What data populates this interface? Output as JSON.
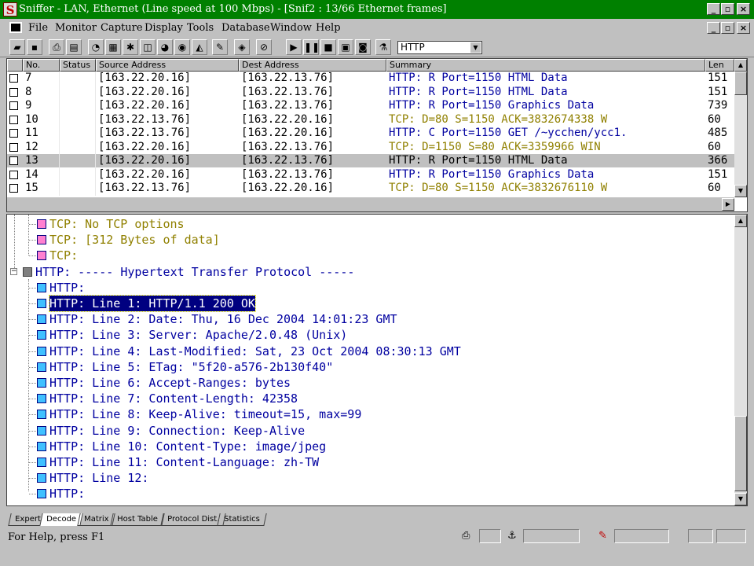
{
  "window": {
    "title": "Sniffer - LAN, Ethernet (Line speed at 100 Mbps) - [Snif2 : 13/66 Ethernet frames]",
    "logo": "S"
  },
  "menu": [
    "File",
    "Monitor",
    "Capture",
    "Display",
    "Tools",
    "Database",
    "Window",
    "Help"
  ],
  "toolbar": {
    "filter_value": "HTTP"
  },
  "packet_list": {
    "columns": [
      "No.",
      "Status",
      "Source Address",
      "Dest Address",
      "Summary",
      "Len"
    ],
    "rows": [
      {
        "no": "7",
        "src": "[163.22.20.16]",
        "dst": "[163.22.13.76]",
        "summary": "HTTP: R Port=1150 HTML Data",
        "len": "151",
        "proto": "http"
      },
      {
        "no": "8",
        "src": "[163.22.20.16]",
        "dst": "[163.22.13.76]",
        "summary": "HTTP: R Port=1150 HTML Data",
        "len": "151",
        "proto": "http"
      },
      {
        "no": "9",
        "src": "[163.22.20.16]",
        "dst": "[163.22.13.76]",
        "summary": "HTTP: R Port=1150 Graphics Data",
        "len": "739",
        "proto": "http"
      },
      {
        "no": "10",
        "src": "[163.22.13.76]",
        "dst": "[163.22.20.16]",
        "summary": "TCP: D=80 S=1150      ACK=3832674338 W",
        "len": "60",
        "proto": "tcp"
      },
      {
        "no": "11",
        "src": "[163.22.13.76]",
        "dst": "[163.22.20.16]",
        "summary": "HTTP: C Port=1150 GET /~ycchen/ycc1.",
        "len": "485",
        "proto": "http"
      },
      {
        "no": "12",
        "src": "[163.22.20.16]",
        "dst": "[163.22.13.76]",
        "summary": "TCP: D=1150 S=80      ACK=3359966 WIN",
        "len": "60",
        "proto": "tcp"
      },
      {
        "no": "13",
        "src": "[163.22.20.16]",
        "dst": "[163.22.13.76]",
        "summary": "HTTP: R Port=1150 HTML Data",
        "len": "366",
        "proto": "black",
        "selected": true
      },
      {
        "no": "14",
        "src": "[163.22.20.16]",
        "dst": "[163.22.13.76]",
        "summary": "HTTP: R Port=1150 Graphics Data",
        "len": "151",
        "proto": "http"
      },
      {
        "no": "15",
        "src": "[163.22.13.76]",
        "dst": "[163.22.20.16]",
        "summary": "TCP: D=80 S=1150      ACK=3832676110 W",
        "len": "60",
        "proto": "tcp"
      }
    ]
  },
  "decode": {
    "lines": [
      {
        "text": "TCP: No TCP options",
        "proto": "tcp",
        "level": 2
      },
      {
        "text": "TCP: [312 Bytes of data]",
        "proto": "tcp",
        "level": 2
      },
      {
        "text": "TCP:",
        "proto": "tcp",
        "level": 2
      },
      {
        "text": "HTTP: ----- Hypertext Transfer Protocol -----",
        "proto": "http",
        "level": 1
      },
      {
        "text": "HTTP:",
        "proto": "http",
        "level": 2
      },
      {
        "text": "HTTP: Line  1:  HTTP/1.1 200 OK",
        "proto": "http",
        "level": 2,
        "selected": true
      },
      {
        "text": "HTTP: Line  2:  Date: Thu, 16 Dec 2004 14:01:23 GMT",
        "proto": "http",
        "level": 2
      },
      {
        "text": "HTTP: Line  3:  Server: Apache/2.0.48 (Unix)",
        "proto": "http",
        "level": 2
      },
      {
        "text": "HTTP: Line  4:  Last-Modified: Sat, 23 Oct 2004 08:30:13 GMT",
        "proto": "http",
        "level": 2
      },
      {
        "text": "HTTP: Line  5:  ETag: \"5f20-a576-2b130f40\"",
        "proto": "http",
        "level": 2
      },
      {
        "text": "HTTP: Line  6:  Accept-Ranges: bytes",
        "proto": "http",
        "level": 2
      },
      {
        "text": "HTTP: Line  7:  Content-Length: 42358",
        "proto": "http",
        "level": 2
      },
      {
        "text": "HTTP: Line  8:  Keep-Alive: timeout=15, max=99",
        "proto": "http",
        "level": 2
      },
      {
        "text": "HTTP: Line  9:  Connection: Keep-Alive",
        "proto": "http",
        "level": 2
      },
      {
        "text": "HTTP: Line 10:  Content-Type: image/jpeg",
        "proto": "http",
        "level": 2
      },
      {
        "text": "HTTP: Line 11:  Content-Language: zh-TW",
        "proto": "http",
        "level": 2
      },
      {
        "text": "HTTP: Line 12:",
        "proto": "http",
        "level": 2
      },
      {
        "text": "HTTP:",
        "proto": "http",
        "level": 2
      }
    ]
  },
  "tabs": [
    {
      "label": "Expert",
      "active": false
    },
    {
      "label": "Decode",
      "active": true
    },
    {
      "label": "Matrix",
      "active": false
    },
    {
      "label": "Host Table",
      "active": false
    },
    {
      "label": "Protocol Dist.",
      "active": false
    },
    {
      "label": "Statistics",
      "active": false
    }
  ],
  "status": {
    "help_text": "For Help, press F1"
  },
  "colors": {
    "http": "#0000a0",
    "tcp": "#908000",
    "title_bg": "#008000",
    "selection": "#000080"
  }
}
